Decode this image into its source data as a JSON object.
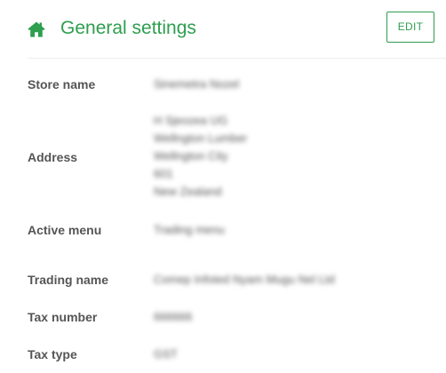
{
  "header": {
    "title": "General settings",
    "edit_label": "EDIT",
    "icon": "home-icon",
    "accent_color": "#2e9e4f"
  },
  "fields": {
    "store_name": {
      "label": "Store name",
      "value": "Sinemetra Nozel"
    },
    "address": {
      "label": "Address",
      "lines": [
        "H Sjeozea UG",
        "Wellngton Lumber",
        "Wellngton City",
        "601",
        "New Zealand"
      ]
    },
    "active_menu": {
      "label": "Active menu",
      "value": "Trading menu"
    },
    "trading_name": {
      "label": "Trading name",
      "value": "Comep Infoted Nyam Mugu Nel Ltd"
    },
    "tax_number": {
      "label": "Tax number",
      "value": "666666"
    },
    "tax_type": {
      "label": "Tax type",
      "value": "GST"
    }
  }
}
